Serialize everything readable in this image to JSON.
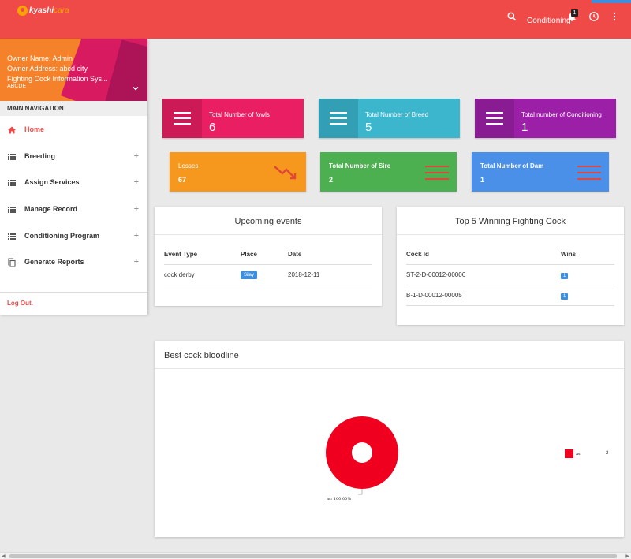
{
  "header": {
    "logo_main": "kyashi",
    "logo_accent": "cara",
    "conditioning_label": "Conditioning",
    "notification_count": "1",
    "icons": [
      "search-icon",
      "bell-icon",
      "clock-icon",
      "more-vert-icon"
    ],
    "color": "#ef4a48"
  },
  "sidebar": {
    "owner_name": "Owner Name: Admin",
    "owner_address": "Owner Address: abcd city",
    "info": "Fighting Cock Information Sys...",
    "code": "ABCDE",
    "nav_header": "MAIN NAVIGATION",
    "items": [
      {
        "label": "Home",
        "icon": "home-icon",
        "active": true
      },
      {
        "label": "Breeding",
        "icon": "list-icon",
        "expand": "+"
      },
      {
        "label": "Assign Services",
        "icon": "list-icon",
        "expand": "+"
      },
      {
        "label": "Manage Record",
        "icon": "list-icon",
        "expand": "+"
      },
      {
        "label": "Conditioning Program",
        "icon": "list-icon",
        "expand": "+"
      },
      {
        "label": "Generate Reports",
        "icon": "copy-icon",
        "expand": "+"
      }
    ],
    "logout": "Log Out."
  },
  "stats": {
    "fowls": {
      "label": "Total Number of fowls",
      "value": "6",
      "color": "#e91e63"
    },
    "breed": {
      "label": "Total Number of Breed",
      "value": "5",
      "color": "#3bb6cd"
    },
    "conditioning": {
      "label": "Total number of Conditioning",
      "value": "1",
      "color": "#9c1fa8"
    },
    "losses": {
      "label": "Losses",
      "value": "67",
      "color": "#f6981e"
    },
    "sire": {
      "label": "Total Number of Sire",
      "value": "2",
      "color": "#4caf50"
    },
    "dam": {
      "label": "Total Number of Dam",
      "value": "1",
      "color": "#4a90e8"
    }
  },
  "upcoming_events": {
    "title": "Upcoming events",
    "columns": [
      "Event Type",
      "Place",
      "Date"
    ],
    "rows": [
      {
        "type": "cock derby",
        "place": "Silay",
        "date": "2018-12-11"
      }
    ]
  },
  "top_winning": {
    "title": "Top 5 Winning Fighting Cock",
    "columns": [
      "Cock Id",
      "Wins"
    ],
    "rows": [
      {
        "id": "ST-2-D-00012-00006",
        "wins": "1"
      },
      {
        "id": "B-1-D-00012-00005",
        "wins": "1"
      }
    ]
  },
  "bloodline": {
    "title": "Best cock bloodline",
    "chart_data": {
      "type": "pie",
      "categories": [
        "as"
      ],
      "values": [
        2
      ],
      "slice_label": "as: 100.00%",
      "legend": [
        {
          "name": "as",
          "value": "2",
          "color": "#f0001e"
        }
      ],
      "legend_position": "right"
    }
  }
}
